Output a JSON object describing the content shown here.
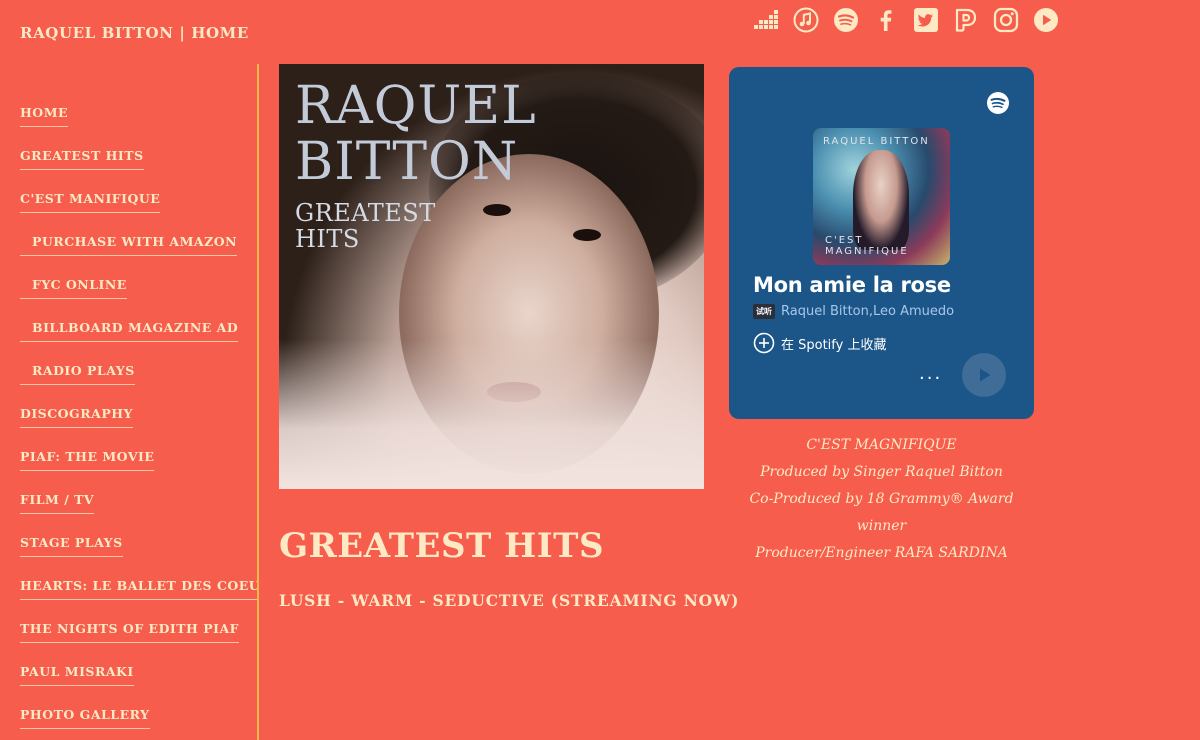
{
  "header": {
    "site_title": "RAQUEL BITTON | HOME",
    "social_icons": [
      "deezer-icon",
      "apple-music-icon",
      "spotify-icon",
      "facebook-icon",
      "twitter-icon",
      "pandora-icon",
      "instagram-icon",
      "youtube-icon"
    ]
  },
  "sidebar": {
    "items": [
      {
        "label": "HOME",
        "sub": false
      },
      {
        "label": "GREATEST HITS",
        "sub": false
      },
      {
        "label": "C'EST MANIFIQUE",
        "sub": false
      },
      {
        "label": "PURCHASE WITH AMAZON",
        "sub": true
      },
      {
        "label": "FYC ONLINE",
        "sub": true
      },
      {
        "label": "BILLBOARD MAGAZINE AD",
        "sub": true
      },
      {
        "label": "RADIO PLAYS",
        "sub": true
      },
      {
        "label": "DISCOGRAPHY",
        "sub": false
      },
      {
        "label": "PIAF: THE MOVIE",
        "sub": false
      },
      {
        "label": "FILM / TV",
        "sub": false
      },
      {
        "label": "STAGE PLAYS",
        "sub": false
      },
      {
        "label": "HEARTS: LE BALLET DES COEURS",
        "sub": false
      },
      {
        "label": "THE NIGHTS OF EDITH PIAF",
        "sub": false
      },
      {
        "label": "PAUL MISRAKI",
        "sub": false
      },
      {
        "label": "PHOTO GALLERY",
        "sub": false
      }
    ]
  },
  "album": {
    "title_line1": "RAQUEL",
    "title_line2": "BITTON",
    "subtitle_line1": "GREATEST",
    "subtitle_line2": "HITS"
  },
  "main": {
    "heading": "GREATEST HITS",
    "tagline": "LUSH - WARM - SEDUCTIVE (STREAMING NOW)"
  },
  "spotify_embed": {
    "cover_top_text": "RAQUEL BITTON",
    "cover_bottom_text": "C'EST MAGNIFIQUE",
    "song_title": "Mon amie la rose",
    "badge": "试听",
    "artists": "Raquel Bitton,Leo Amuedo",
    "save_label": "在 Spotify 上收藏",
    "more_label": "...",
    "colors": {
      "background": "#1c5688",
      "play_button": "#3f6d97"
    }
  },
  "caption": {
    "lines": [
      "C'EST MAGNIFIQUE",
      "Produced by Singer Raquel Bitton",
      "Co-Produced by 18 Grammy® Award",
      "winner",
      "Producer/Engineer RAFA SARDINA"
    ]
  },
  "colors": {
    "page_background": "#f65d4d",
    "text": "#fde9c4",
    "divider": "#f7b84b"
  }
}
